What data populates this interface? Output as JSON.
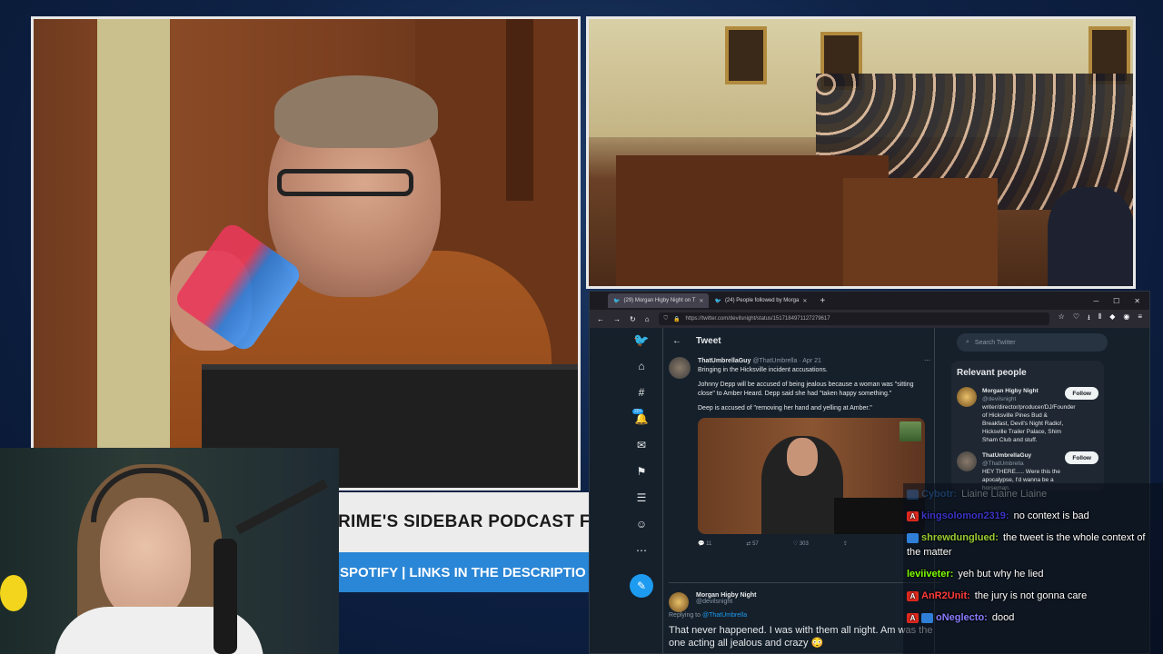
{
  "browser": {
    "tabs": [
      {
        "label": "(29) Morgan Higby Night on T"
      },
      {
        "label": "(24) People followed by Morga"
      }
    ],
    "new_tab": "+",
    "url": "https://twitter.com/devilsnight/status/1517184971127279617"
  },
  "twitter": {
    "header_title": "Tweet",
    "search_placeholder": "Search Twitter",
    "notification_count": "20+",
    "tweet": {
      "author": "ThatUmbrellaGuy",
      "handle_date": "@ThatUmbrella · Apr 21",
      "line1": "Bringing in the Hicksville incident accusations.",
      "para2": "Johnny Depp will be accused of being jealous because a woman was \"sitting close\" to Amber Heard. Depp said she had \"taken happy something.\"",
      "para3": "Deep is accused of \"removing her hand and yelling at Amber.\"",
      "reply_count": "11",
      "retweet_count": "57",
      "like_count": "303"
    },
    "reply": {
      "name": "Morgan Higby Night",
      "handle": "@devilsnight",
      "replying_prefix": "Replying to",
      "replying_to": "@ThatUmbrella",
      "text": "That never happened. I was with them all night. Am was the one acting all jealous and crazy 😳"
    },
    "relevant": {
      "title": "Relevant people",
      "people": [
        {
          "name": "Morgan Higby Night",
          "handle": "@devilsnight",
          "bio": "writer/director/producer/DJ/Founder of Hicksville Pines Bud & Breakfast, Devil's Night Radio!, Hicksville Trailer Palace, Shim Sham Club and stuff.",
          "follow": "Follow"
        },
        {
          "name": "ThatUmbrellaGuy",
          "handle": "@ThatUmbrella",
          "bio": "HEY THERE..... Were this the apocalypse, I'd wanna be a horseman.",
          "follow": "Follow"
        }
      ]
    }
  },
  "chat": {
    "messages": [
      {
        "user": "Cybotr:",
        "text": "Liaine Liaine Liaine",
        "color": "#2f7fd9",
        "faded": true
      },
      {
        "user": "kingsolomon2319:",
        "text": "no context is bad",
        "color": "#3b34c9"
      },
      {
        "user": "shrewdunglued:",
        "text": "the tweet is the whole context of the matter",
        "color": "#9acd32"
      },
      {
        "user": "leviiveter:",
        "text": "yeh but why he lied",
        "color": "#7fff00"
      },
      {
        "user": "AnR2Unit:",
        "text": "the jury is not gonna care",
        "color": "#ff3b3b"
      },
      {
        "user": "oNeglecto:",
        "text": "dood",
        "color": "#8a7cff"
      }
    ]
  },
  "overlay": {
    "podcast_top": "RIME'S SIDEBAR PODCAST FO",
    "podcast_bottom": "SPOTIFY | LINKS IN THE DESCRIPTIO"
  }
}
